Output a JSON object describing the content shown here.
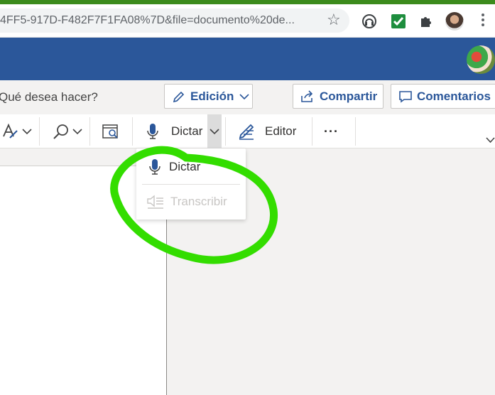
{
  "browser": {
    "url": "4FF5-917D-F482F7F1FA08%7D&file=documento%20de...",
    "icons": [
      "bookmark-star-icon",
      "extension-circle-icon",
      "extension-check-icon",
      "extensions-puzzle-icon",
      "profile-avatar",
      "menu-kebab-icon"
    ],
    "check_color": "#1e8e3e"
  },
  "header": {
    "color": "#2b579a"
  },
  "commands": {
    "search_placeholder": "Qué desea hacer?",
    "edit_mode_label": "Edición",
    "share_label": "Compartir",
    "comments_label": "Comentarios"
  },
  "ribbon": {
    "dictate_label": "Dictar",
    "editor_label": "Editor",
    "more_label": "···"
  },
  "dictate_menu": {
    "items": [
      {
        "label": "Dictar",
        "enabled": true
      },
      {
        "label": "Transcribir",
        "enabled": false
      }
    ]
  },
  "annotation": {
    "color": "#33dd00"
  }
}
